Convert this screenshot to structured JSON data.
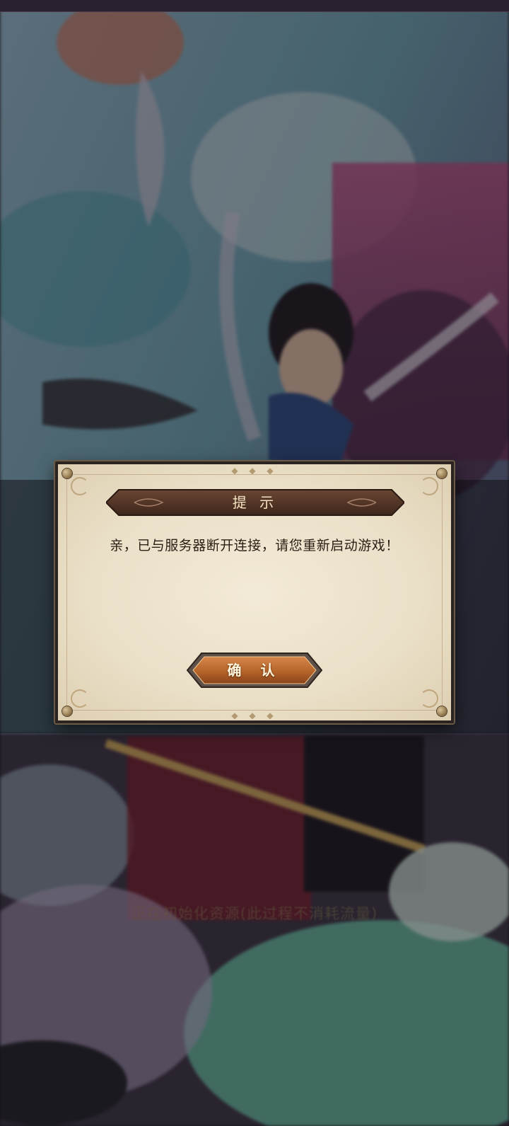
{
  "dialog": {
    "title": "提 示",
    "message": "亲，已与服务器断开连接，请您重新启动游戏！",
    "confirm_label": "确 认"
  },
  "loading": {
    "status_text": "正在初始化资源(此过程不消耗流量)"
  },
  "colors": {
    "dialog_paper": "#eadfc7",
    "title_bar": "#4a2f22",
    "confirm_button": "#b5642a",
    "message_text": "#2a2016"
  }
}
